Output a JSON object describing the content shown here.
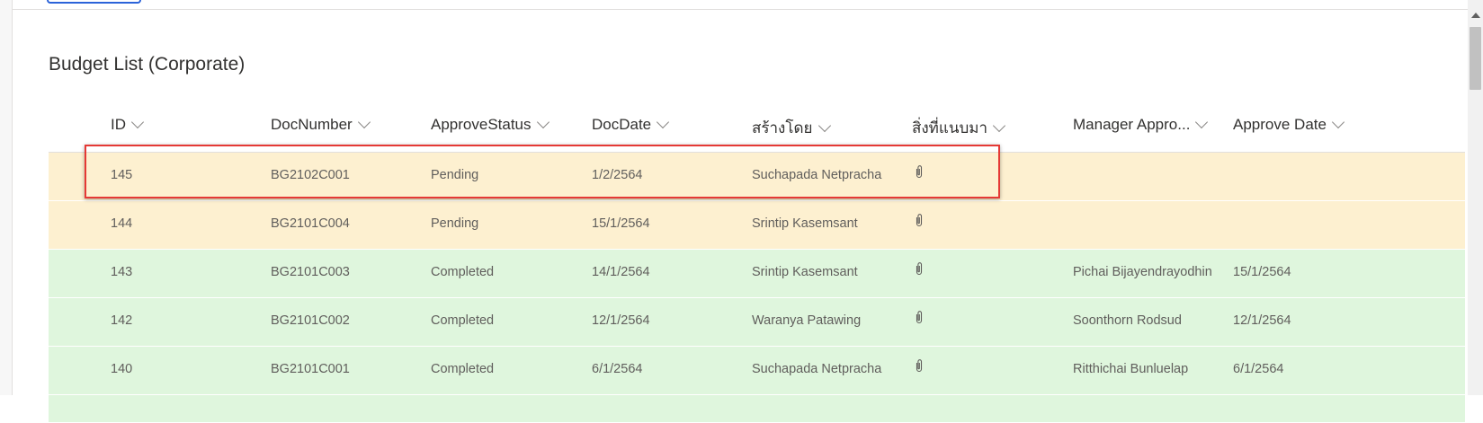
{
  "title": "Budget List (Corporate)",
  "columns": [
    {
      "label": "ID"
    },
    {
      "label": "DocNumber"
    },
    {
      "label": "ApproveStatus"
    },
    {
      "label": "DocDate"
    },
    {
      "label": "สร้างโดย"
    },
    {
      "label": "สิ่งที่แนบมา"
    },
    {
      "label": "Manager Appro..."
    },
    {
      "label": "Approve Date"
    }
  ],
  "rows": [
    {
      "id": "145",
      "doc_number": "BG2102C001",
      "approve_status": "Pending",
      "doc_date": "1/2/2564",
      "created_by": "Suchapada Netpracha",
      "attachment": "paperclip-icon",
      "manager": "",
      "approve_date": ""
    },
    {
      "id": "144",
      "doc_number": "BG2101C004",
      "approve_status": "Pending",
      "doc_date": "15/1/2564",
      "created_by": "Srintip Kasemsant",
      "attachment": "paperclip-icon",
      "manager": "",
      "approve_date": ""
    },
    {
      "id": "143",
      "doc_number": "BG2101C003",
      "approve_status": "Completed",
      "doc_date": "14/1/2564",
      "created_by": "Srintip Kasemsant",
      "attachment": "paperclip-icon",
      "manager": "Pichai Bijayendrayodhin",
      "approve_date": "15/1/2564"
    },
    {
      "id": "142",
      "doc_number": "BG2101C002",
      "approve_status": "Completed",
      "doc_date": "12/1/2564",
      "created_by": "Waranya Patawing",
      "attachment": "paperclip-icon",
      "manager": "Soonthorn Rodsud",
      "approve_date": "12/1/2564"
    },
    {
      "id": "140",
      "doc_number": "BG2101C001",
      "approve_status": "Completed",
      "doc_date": "6/1/2564",
      "created_by": "Suchapada Netpracha",
      "attachment": "paperclip-icon",
      "manager": "Ritthichai Bunluelap",
      "approve_date": "6/1/2564"
    }
  ],
  "colors": {
    "pending_row": "#fdf0d0",
    "completed_row": "#dff6dd",
    "highlight_border": "#e53935",
    "accent": "#2b63d9"
  }
}
